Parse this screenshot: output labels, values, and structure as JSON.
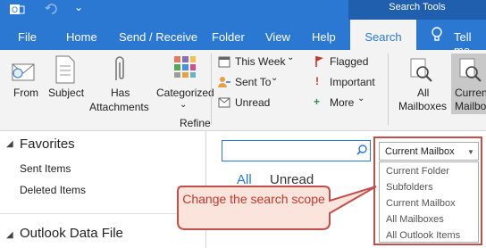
{
  "titlebar": {
    "contextual_group": "Search Tools"
  },
  "tabs": [
    {
      "label": "File"
    },
    {
      "label": "Home"
    },
    {
      "label": "Send / Receive"
    },
    {
      "label": "Folder"
    },
    {
      "label": "View"
    },
    {
      "label": "Help"
    },
    {
      "label": "Search"
    },
    {
      "label": "Tell me"
    }
  ],
  "ribbon": {
    "from": "From",
    "subject": "Subject",
    "has1": "Has",
    "has2": "Attachments",
    "categorized": "Categorized",
    "this_week": "This Week",
    "sent_to": "Sent To",
    "unread": "Unread",
    "flagged": "Flagged",
    "important": "Important",
    "more": "More",
    "refine": "Refine",
    "all": "All",
    "mailboxes": "Mailboxes",
    "current": "Current",
    "mailbox_short": "Mailbo"
  },
  "left": {
    "favorites": "Favorites",
    "sent": "Sent Items",
    "deleted": "Deleted Items",
    "data_file": "Outlook Data File"
  },
  "right": {
    "all": "All",
    "unread": "Unread"
  },
  "scope": {
    "selected": "Current Mailbox",
    "options": [
      "Current Folder",
      "Subfolders",
      "Current Mailbox",
      "All Mailboxes",
      "All Outlook Items"
    ]
  },
  "callout": {
    "text": "Change the search scope"
  },
  "colors": {
    "accent": "#2b78d2",
    "callout": "#c0504d"
  }
}
